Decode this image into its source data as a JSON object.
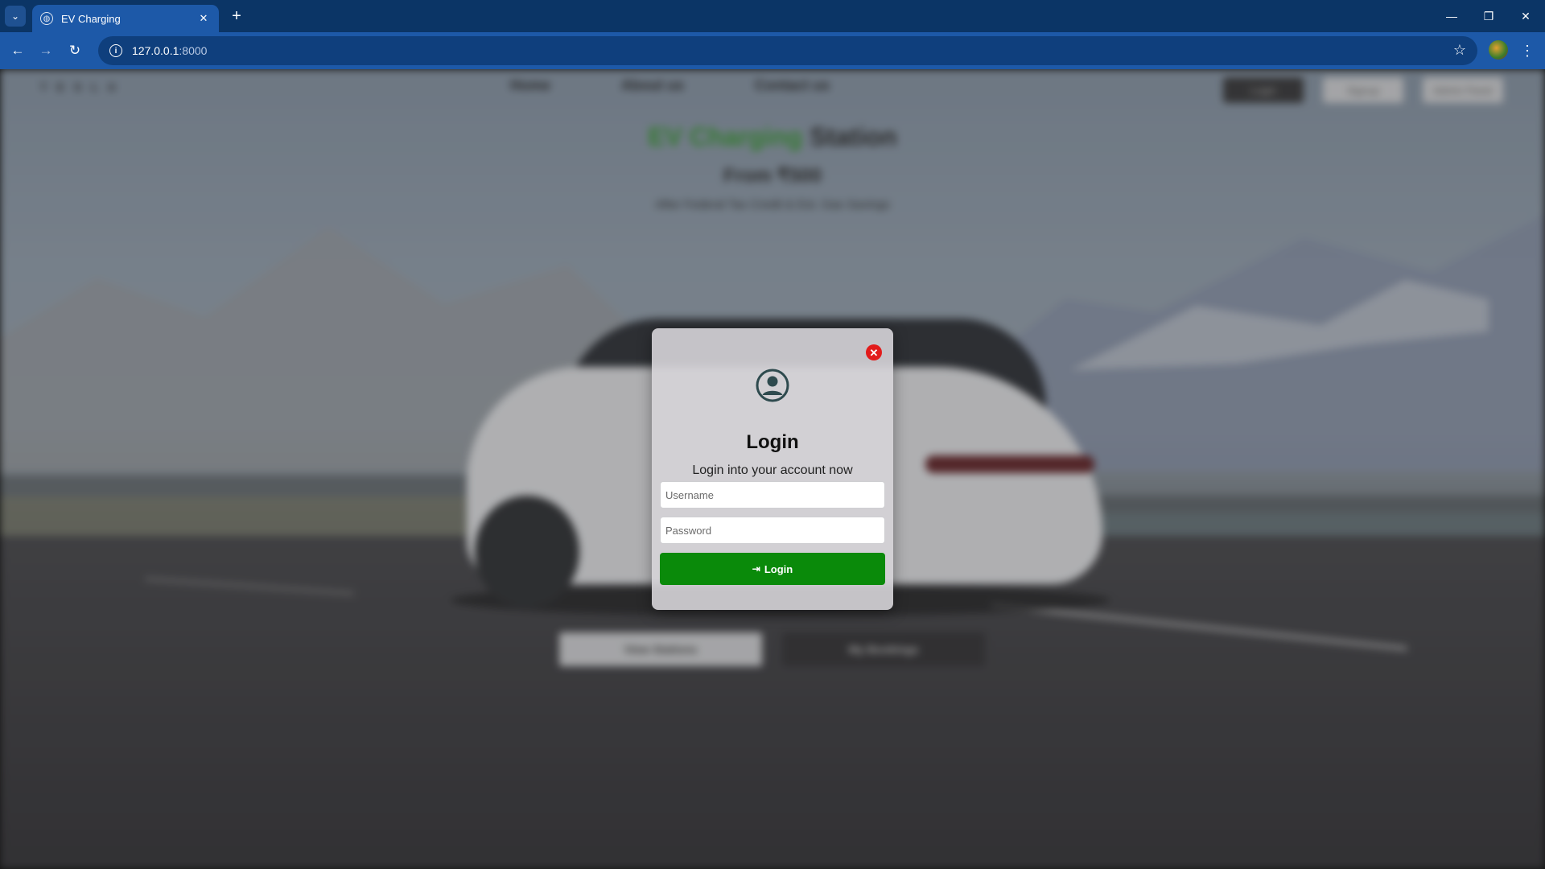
{
  "browser": {
    "tab_title": "EV Charging",
    "url_host": "127.0.0.1",
    "url_port": ":8000"
  },
  "site": {
    "logo": "TESLA",
    "nav": [
      "Home",
      "About us",
      "Contact us"
    ],
    "header_buttons": [
      "Login",
      "Signup",
      "Admin Panel"
    ],
    "hero_title_green": "EV Charging",
    "hero_title_rest": " Station",
    "hero_sub": "From ₹500",
    "hero_small": "After Federal Tax Credit & Est. Gas Savings",
    "cta_primary": "View Stations",
    "cta_secondary": "My Bookings"
  },
  "modal": {
    "title": "Login",
    "subtitle": "Login into your account now",
    "username_placeholder": "Username",
    "password_placeholder": "Password",
    "login_label": "Login",
    "close_icon": "close-icon",
    "user_icon": "user-circle-icon",
    "login_icon": "sign-in-icon"
  },
  "colors": {
    "browser_frame": "#0b3566",
    "browser_toolbar": "#1d59a8",
    "login_button": "#0a8a0a",
    "close_button": "#e21b1b",
    "accent_green": "#2f8f2a"
  }
}
